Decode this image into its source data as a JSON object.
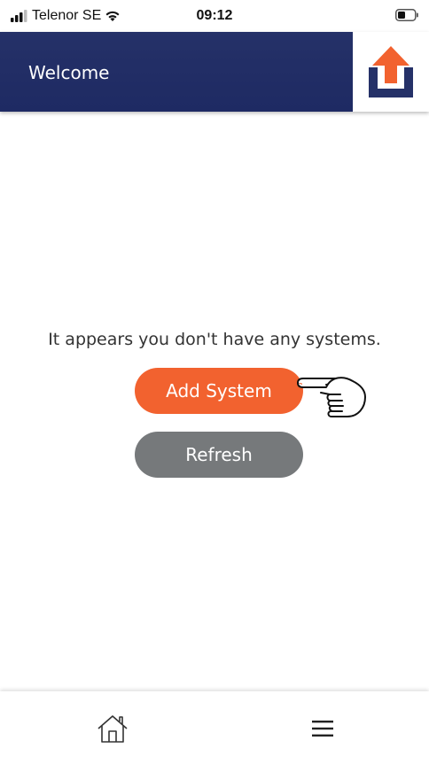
{
  "status_bar": {
    "carrier": "Telenor SE",
    "time": "09:12",
    "icons": [
      "signal-icon",
      "wifi-icon",
      "battery-icon"
    ]
  },
  "header": {
    "title": "Welcome",
    "logo_icon": "upload-logo-icon"
  },
  "main": {
    "message": "It appears you don't have any systems.",
    "add_system_label": "Add System",
    "refresh_label": "Refresh",
    "pointer_icon": "pointing-hand-icon"
  },
  "bottom_nav": {
    "items": [
      "home-icon",
      "menu-icon"
    ]
  },
  "colors": {
    "header_bg": "#253168",
    "accent_orange": "#f2622f",
    "refresh_gray": "#76797b",
    "logo_orange": "#f2622f",
    "logo_navy": "#253168"
  }
}
